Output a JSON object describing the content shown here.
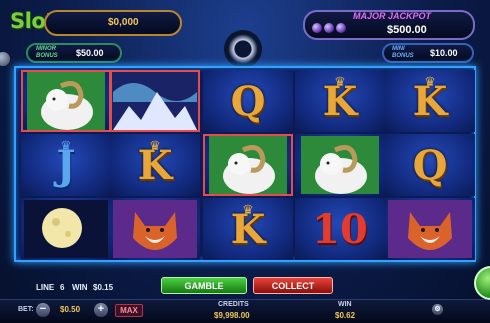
{
  "watermark": "SlotCatalog",
  "jackpots": {
    "grand": {
      "value": "$0,000"
    },
    "major": {
      "label": "MAJOR JACKPOT",
      "value": "$500.00"
    },
    "minor": {
      "label": "MINOR BONUS",
      "value": "$50.00"
    },
    "mini": {
      "label": "MINI BONUS",
      "value": "$10.00"
    }
  },
  "reels": [
    [
      {
        "symbol": "ram",
        "win": true
      },
      {
        "symbol": "jack",
        "text": "J"
      },
      {
        "symbol": "moon"
      }
    ],
    [
      {
        "symbol": "aurora",
        "win": true
      },
      {
        "symbol": "king",
        "text": "K"
      },
      {
        "symbol": "fox"
      }
    ],
    [
      {
        "symbol": "queen",
        "text": "Q"
      },
      {
        "symbol": "ram",
        "win": true
      },
      {
        "symbol": "king",
        "text": "K"
      }
    ],
    [
      {
        "symbol": "king",
        "text": "K"
      },
      {
        "symbol": "ram"
      },
      {
        "symbol": "ten",
        "text": "10"
      }
    ],
    [
      {
        "symbol": "king",
        "text": "K"
      },
      {
        "symbol": "queen",
        "text": "Q"
      },
      {
        "symbol": "fox"
      }
    ]
  ],
  "status": {
    "line_label": "LINE",
    "line_value": "6",
    "win_label": "WIN",
    "win_value": "$0.15"
  },
  "buttons": {
    "gamble": "GAMBLE",
    "collect": "COLLECT",
    "max": "MAX",
    "minus": "−",
    "plus": "+"
  },
  "bet": {
    "label": "BET:",
    "value": "$0.50"
  },
  "credits": {
    "label": "CREDITS",
    "value": "$9,998.00"
  },
  "win": {
    "label": "WIN",
    "value": "$0.62"
  },
  "colors": {
    "accent": "#2fa3ff",
    "gamble": "#2fb52a",
    "collect": "#d0251e",
    "value": "#f2c85b"
  }
}
